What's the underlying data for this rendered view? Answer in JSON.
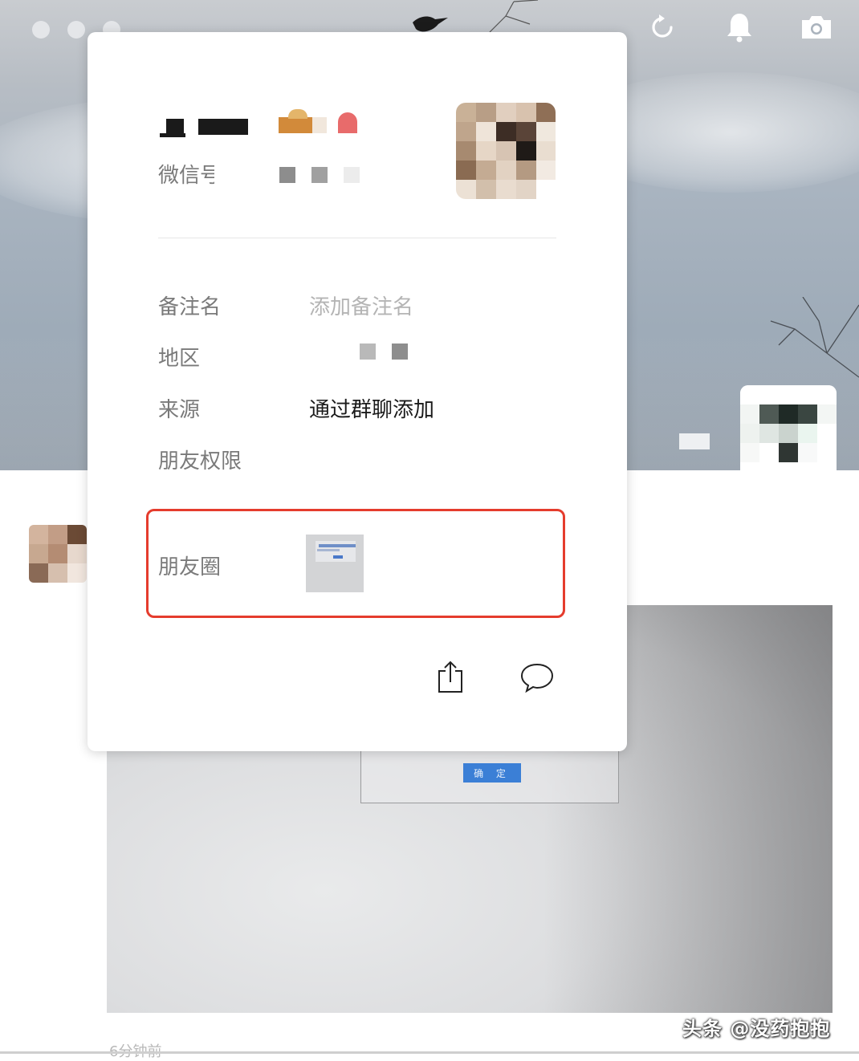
{
  "window": {
    "controls": [
      "close",
      "minimize",
      "zoom"
    ],
    "top_icons": [
      "refresh-icon",
      "bell-icon",
      "camera-icon"
    ]
  },
  "profile": {
    "wechat_id_label": "微信号",
    "fields": [
      {
        "label": "备注名",
        "placeholder": "添加备注名"
      },
      {
        "label": "地区"
      },
      {
        "label": "来源",
        "value": "通过群聊添加"
      },
      {
        "label": "朋友权限"
      }
    ],
    "moments_label": "朋友圈",
    "highlight_color": "#e53c2d",
    "actions": [
      "share-icon",
      "chat-bubble-icon"
    ]
  },
  "feed": {
    "photo_button_text": "确 定",
    "time_text": "6分钟前"
  },
  "watermark": "头条 @没药抱抱"
}
